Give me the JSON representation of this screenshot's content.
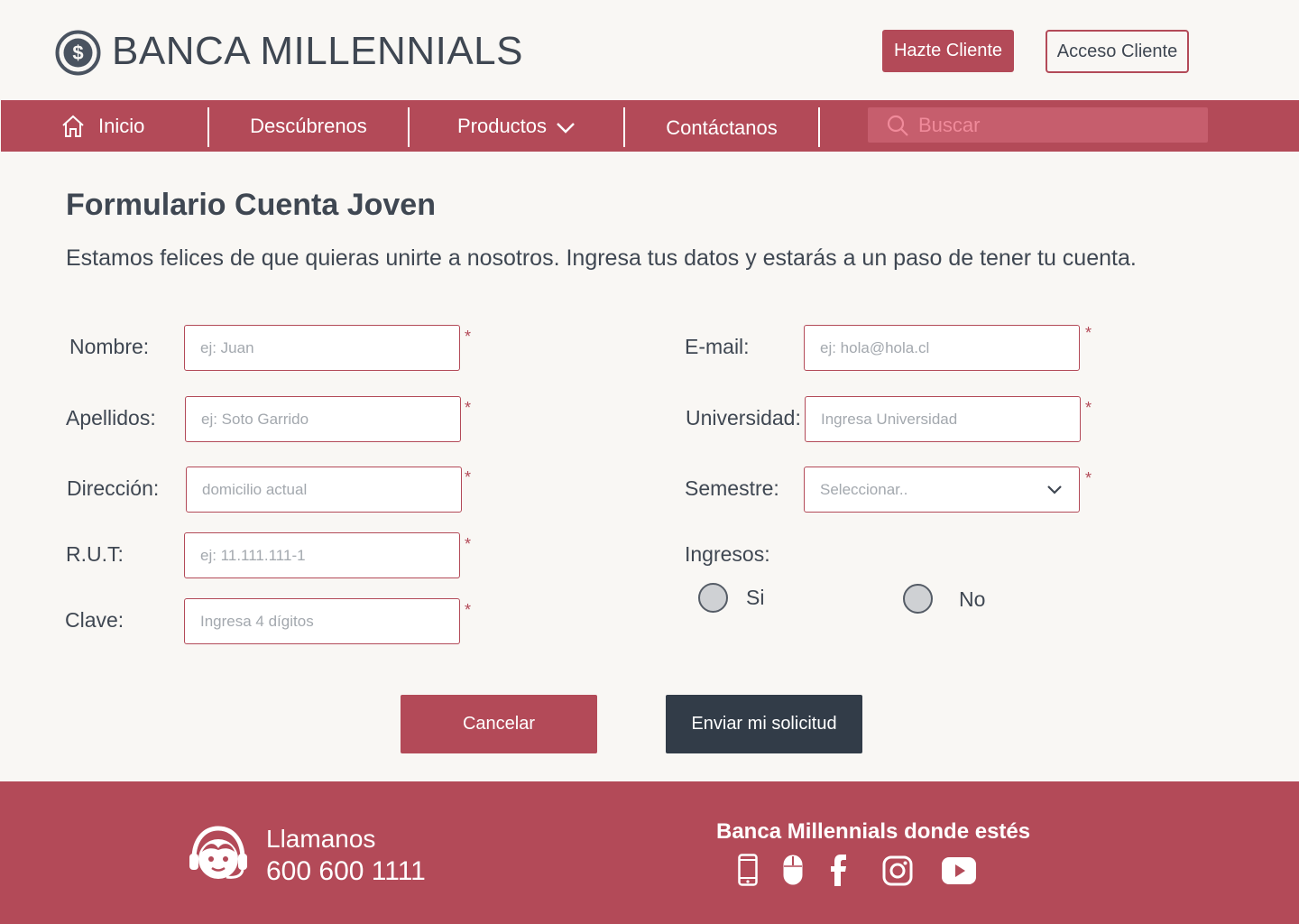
{
  "brand": {
    "name": "BANCA MILLENNIALS",
    "logo_icon": "dollar-circle-icon"
  },
  "header": {
    "cta_primary": "Hazte Cliente",
    "cta_secondary": "Acceso Cliente"
  },
  "nav": {
    "items": [
      {
        "label": "Inicio",
        "icon": "home-icon"
      },
      {
        "label": "Descúbrenos"
      },
      {
        "label": "Productos",
        "icon": "chevron-down-icon"
      },
      {
        "label": "Contáctanos"
      }
    ],
    "search_placeholder": "Buscar"
  },
  "form": {
    "title": "Formulario Cuenta Joven",
    "description": "Estamos felices de que quieras unirte a nosotros. Ingresa tus datos y estarás a un paso de tener tu cuenta.",
    "required_mark": "*",
    "fields": {
      "nombre": {
        "label": "Nombre:",
        "placeholder": "ej: Juan"
      },
      "apellidos": {
        "label": "Apellidos:",
        "placeholder": "ej: Soto Garrido"
      },
      "direccion": {
        "label": "Dirección:",
        "placeholder": "domicilio actual"
      },
      "rut": {
        "label": "R.U.T:",
        "placeholder": "ej: 11.111.111-1"
      },
      "clave": {
        "label": "Clave:",
        "placeholder": "Ingresa 4 dígitos"
      },
      "email": {
        "label": "E-mail:",
        "placeholder": "ej: hola@hola.cl"
      },
      "universidad": {
        "label": "Universidad:",
        "placeholder": "Ingresa Universidad"
      },
      "semestre": {
        "label": "Semestre:",
        "placeholder": "Seleccionar.."
      },
      "ingresos": {
        "label": "Ingresos:",
        "options": [
          "Si",
          "No"
        ]
      }
    },
    "cancel_label": "Cancelar",
    "submit_label": "Enviar mi solicitud"
  },
  "footer": {
    "call_title": "Llamanos",
    "call_number": "600 600 1111",
    "tagline": "Banca Millennials donde estés",
    "social_icons": [
      "mobile-icon",
      "mouse-icon",
      "facebook-icon",
      "instagram-icon",
      "youtube-icon"
    ]
  },
  "colors": {
    "brand": "#b34a58",
    "dark": "#323c48",
    "text": "#3f4752",
    "background": "#f9f7f4"
  }
}
